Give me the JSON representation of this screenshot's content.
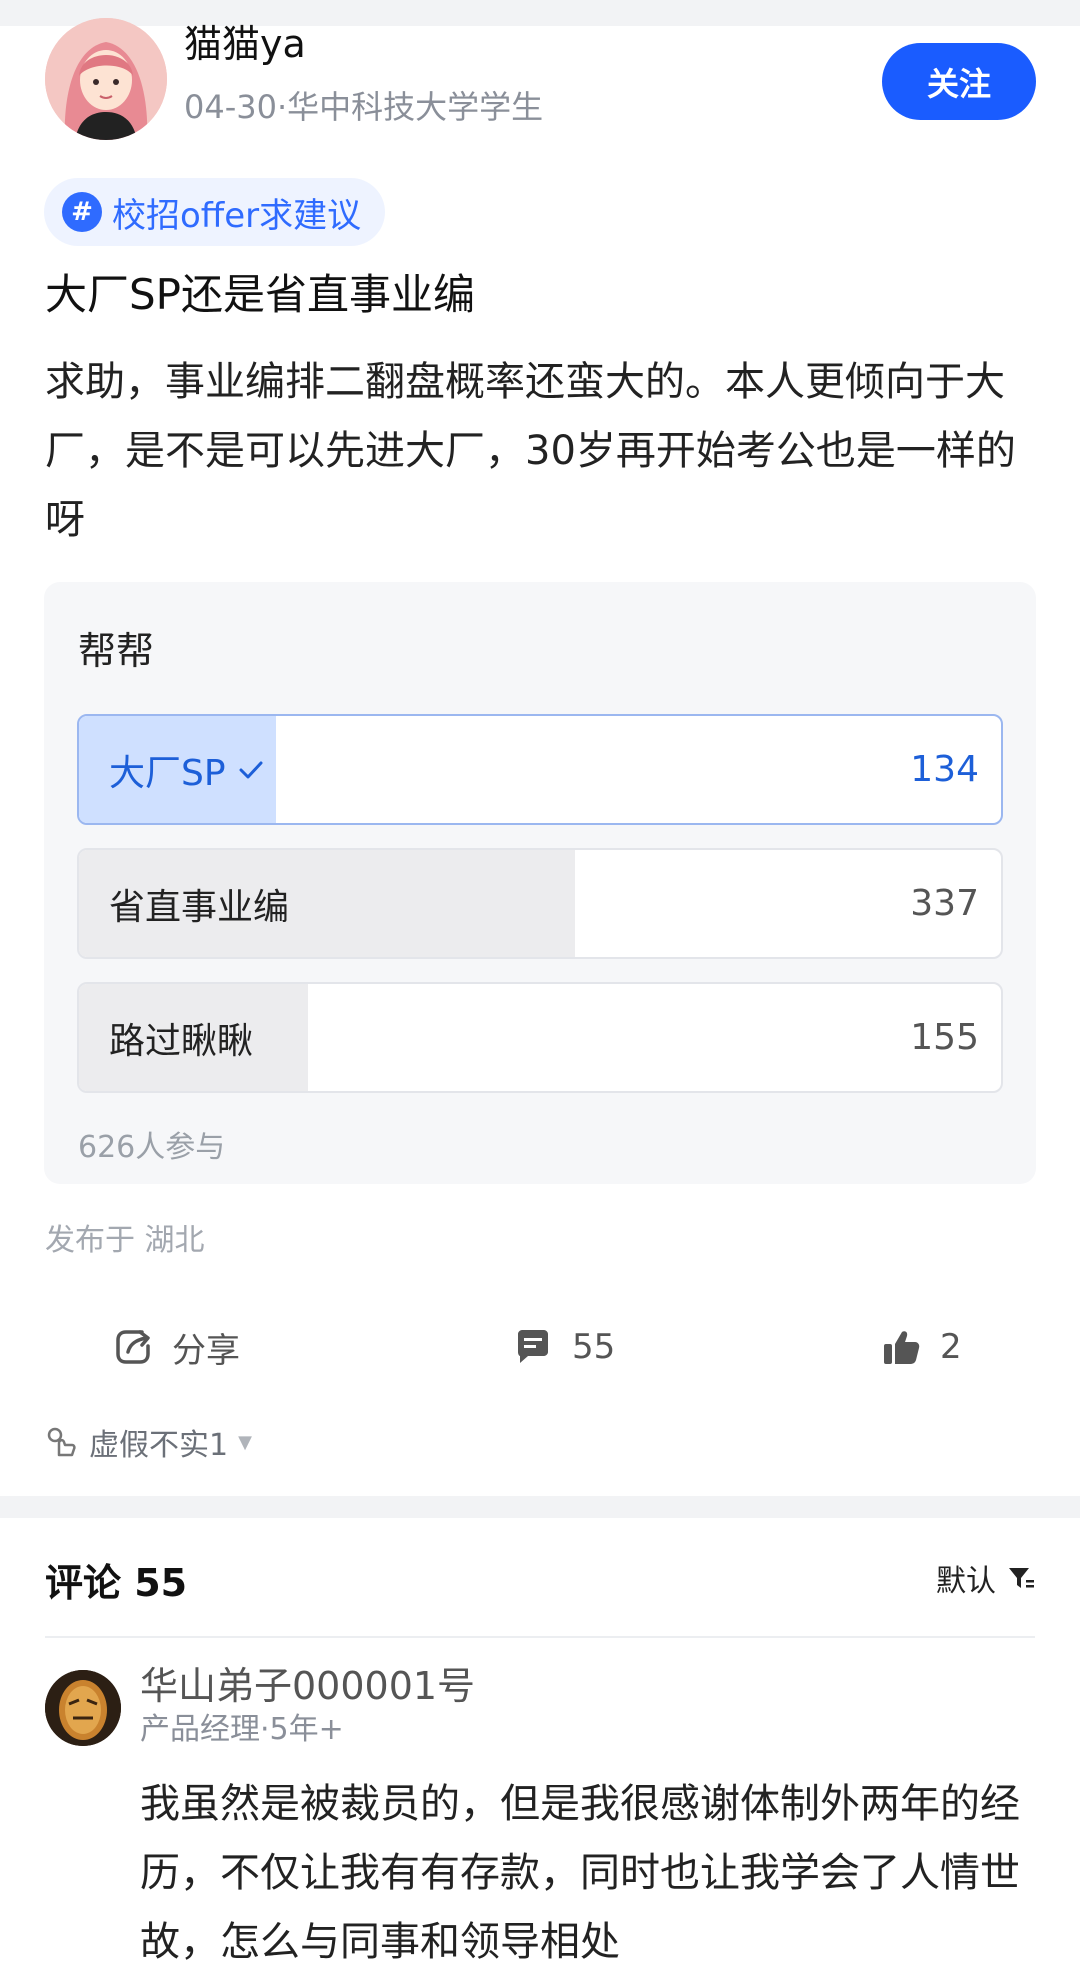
{
  "post": {
    "author": {
      "name": "猫猫ya",
      "date": "04-30",
      "separator": "·",
      "identity": "华中科技大学学生",
      "avatar_icon": "user-avatar-illustration"
    },
    "follow_label": "关注",
    "topic": {
      "icon": "hash-icon",
      "label": "校招offer求建议"
    },
    "title": "大厂SP还是省直事业编",
    "body": "求助，事业编排二翻盘概率还蛮大的。本人更倾向于大厂，是不是可以先进大厂，30岁再开始考公也是一样的呀"
  },
  "poll": {
    "title": "帮帮",
    "options": [
      {
        "label": "大厂SP",
        "count": "134",
        "fraction": 0.214,
        "selected": true
      },
      {
        "label": "省直事业编",
        "count": "337",
        "fraction": 0.538,
        "selected": false
      },
      {
        "label": "路过瞅瞅",
        "count": "155",
        "fraction": 0.248,
        "selected": false
      }
    ],
    "participants": "626人参与"
  },
  "location": "发布于 湖北",
  "actions": {
    "share_label": "分享",
    "comment_count": "55",
    "like_count": "2"
  },
  "reaction": {
    "label": "虚假不实1"
  },
  "comments": {
    "header": "评论 55",
    "sort_label": "默认",
    "items": [
      {
        "user": "华山弟子000001号",
        "meta": "产品经理·5年+",
        "text": "我虽然是被裁员的，但是我很感谢体制外两年的经历，不仅让我有有存款，同时也让我学会了人情世故，怎么与同事和领导相处"
      }
    ]
  },
  "colors": {
    "accent": "#1a5cff",
    "poll_selected_fill": "#cfe0ff",
    "poll_fill": "#ececee"
  }
}
